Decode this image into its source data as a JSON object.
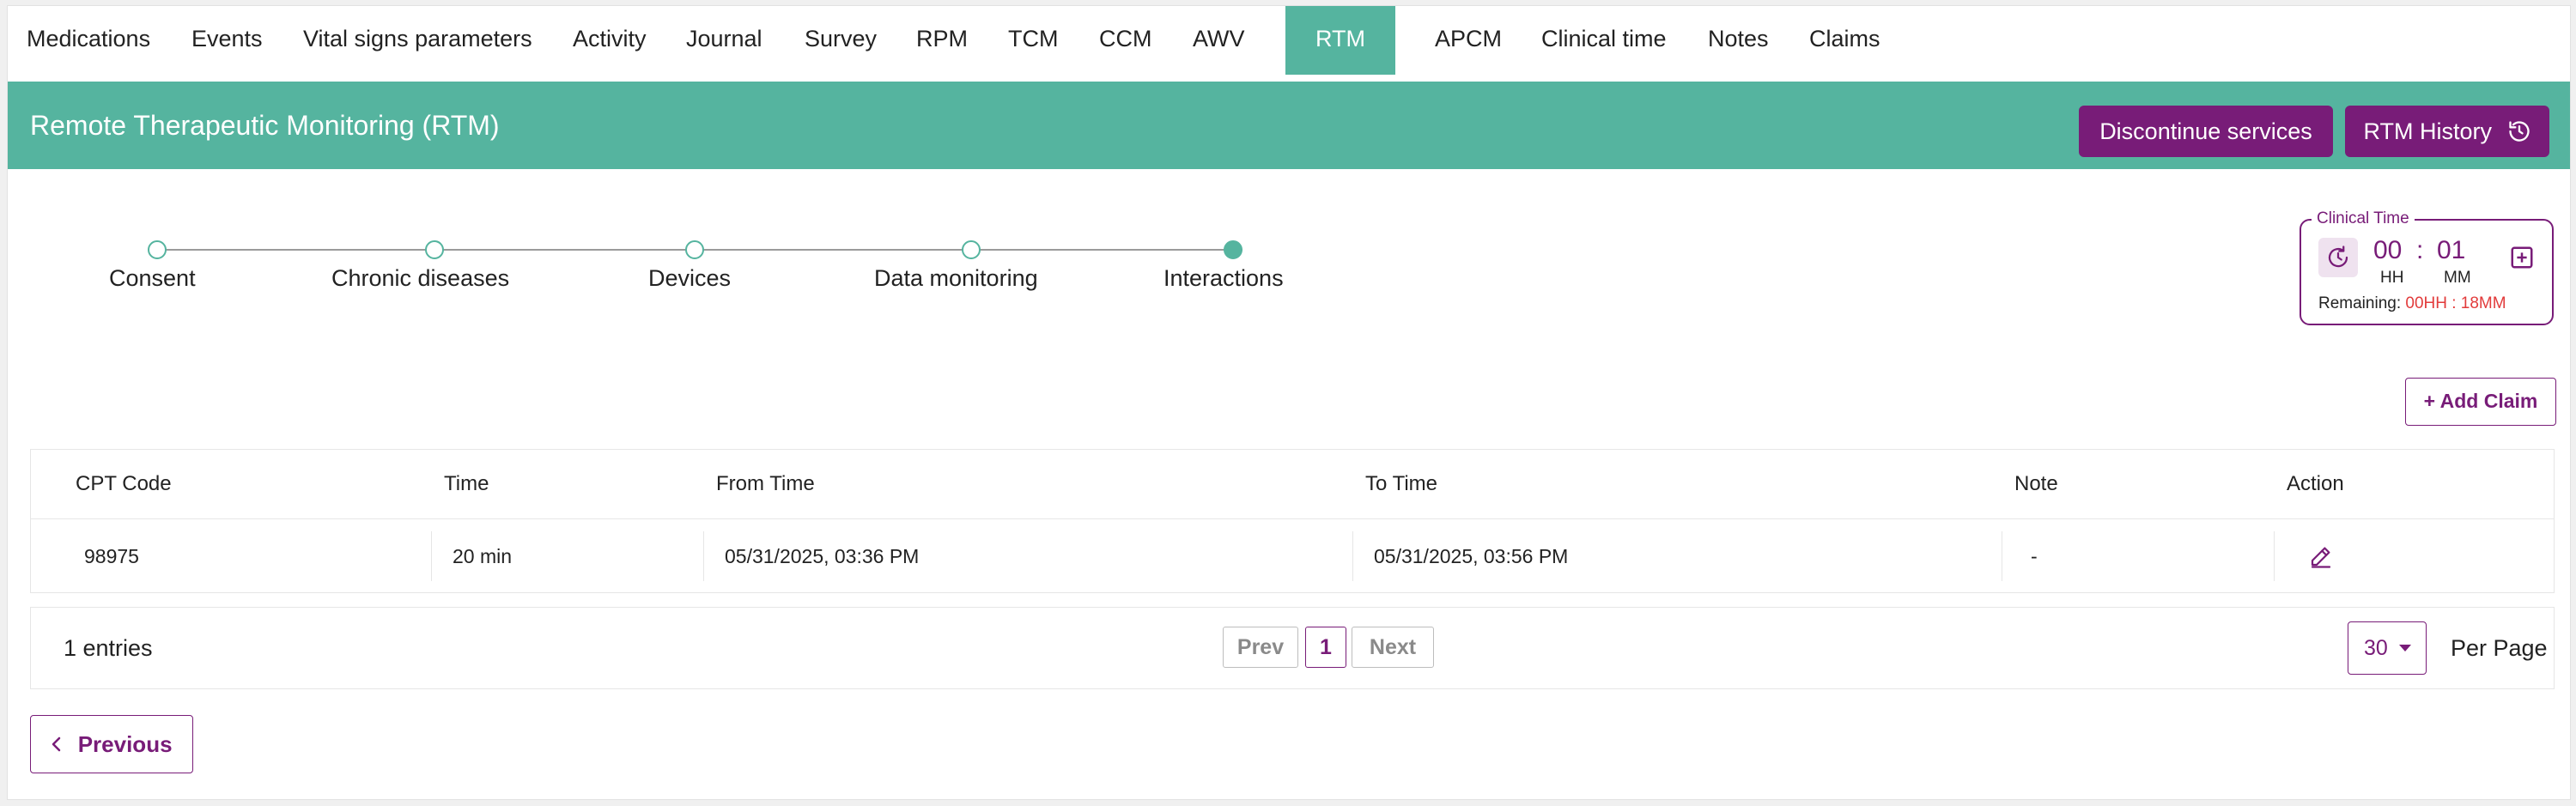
{
  "tabs": [
    {
      "label": "Medications"
    },
    {
      "label": "Events"
    },
    {
      "label": "Vital signs parameters"
    },
    {
      "label": "Activity"
    },
    {
      "label": "Journal"
    },
    {
      "label": "Survey"
    },
    {
      "label": "RPM"
    },
    {
      "label": "TCM"
    },
    {
      "label": "CCM"
    },
    {
      "label": "AWV"
    },
    {
      "label": "RTM"
    },
    {
      "label": "APCM"
    },
    {
      "label": "Clinical time"
    },
    {
      "label": "Notes"
    },
    {
      "label": "Claims"
    }
  ],
  "header": {
    "title": "Remote Therapeutic Monitoring (RTM)",
    "discontinue_label": "Discontinue services",
    "history_label": "RTM History"
  },
  "steps": [
    {
      "label": "Consent",
      "state": "open"
    },
    {
      "label": "Chronic diseases",
      "state": "open"
    },
    {
      "label": "Devices",
      "state": "open"
    },
    {
      "label": "Data monitoring",
      "state": "open"
    },
    {
      "label": "Interactions",
      "state": "current"
    }
  ],
  "clinical_time": {
    "legend": "Clinical Time",
    "hours": "00",
    "separator": ":",
    "minutes": "01",
    "hours_unit": "HH",
    "minutes_unit": "MM",
    "remaining_label": "Remaining:",
    "remaining_value": "00HH : 18MM"
  },
  "add_claim_label": "+ Add Claim",
  "table": {
    "headers": [
      "CPT Code",
      "Time",
      "From Time",
      "To Time",
      "Note",
      "Action"
    ],
    "rows": [
      {
        "cpt": "98975",
        "time": "20 min",
        "from": "05/31/2025, 03:36 PM",
        "to": "05/31/2025, 03:56 PM",
        "note": "-"
      }
    ]
  },
  "pagination": {
    "entries": "1 entries",
    "prev": "Prev",
    "page": "1",
    "next": "Next",
    "per_page_value": "30",
    "per_page_label": "Per Page"
  },
  "previous_label": "Previous",
  "colors": {
    "accent_green": "#55b49f",
    "brand_purple": "#781c78",
    "warning_red": "#e23b3b"
  }
}
